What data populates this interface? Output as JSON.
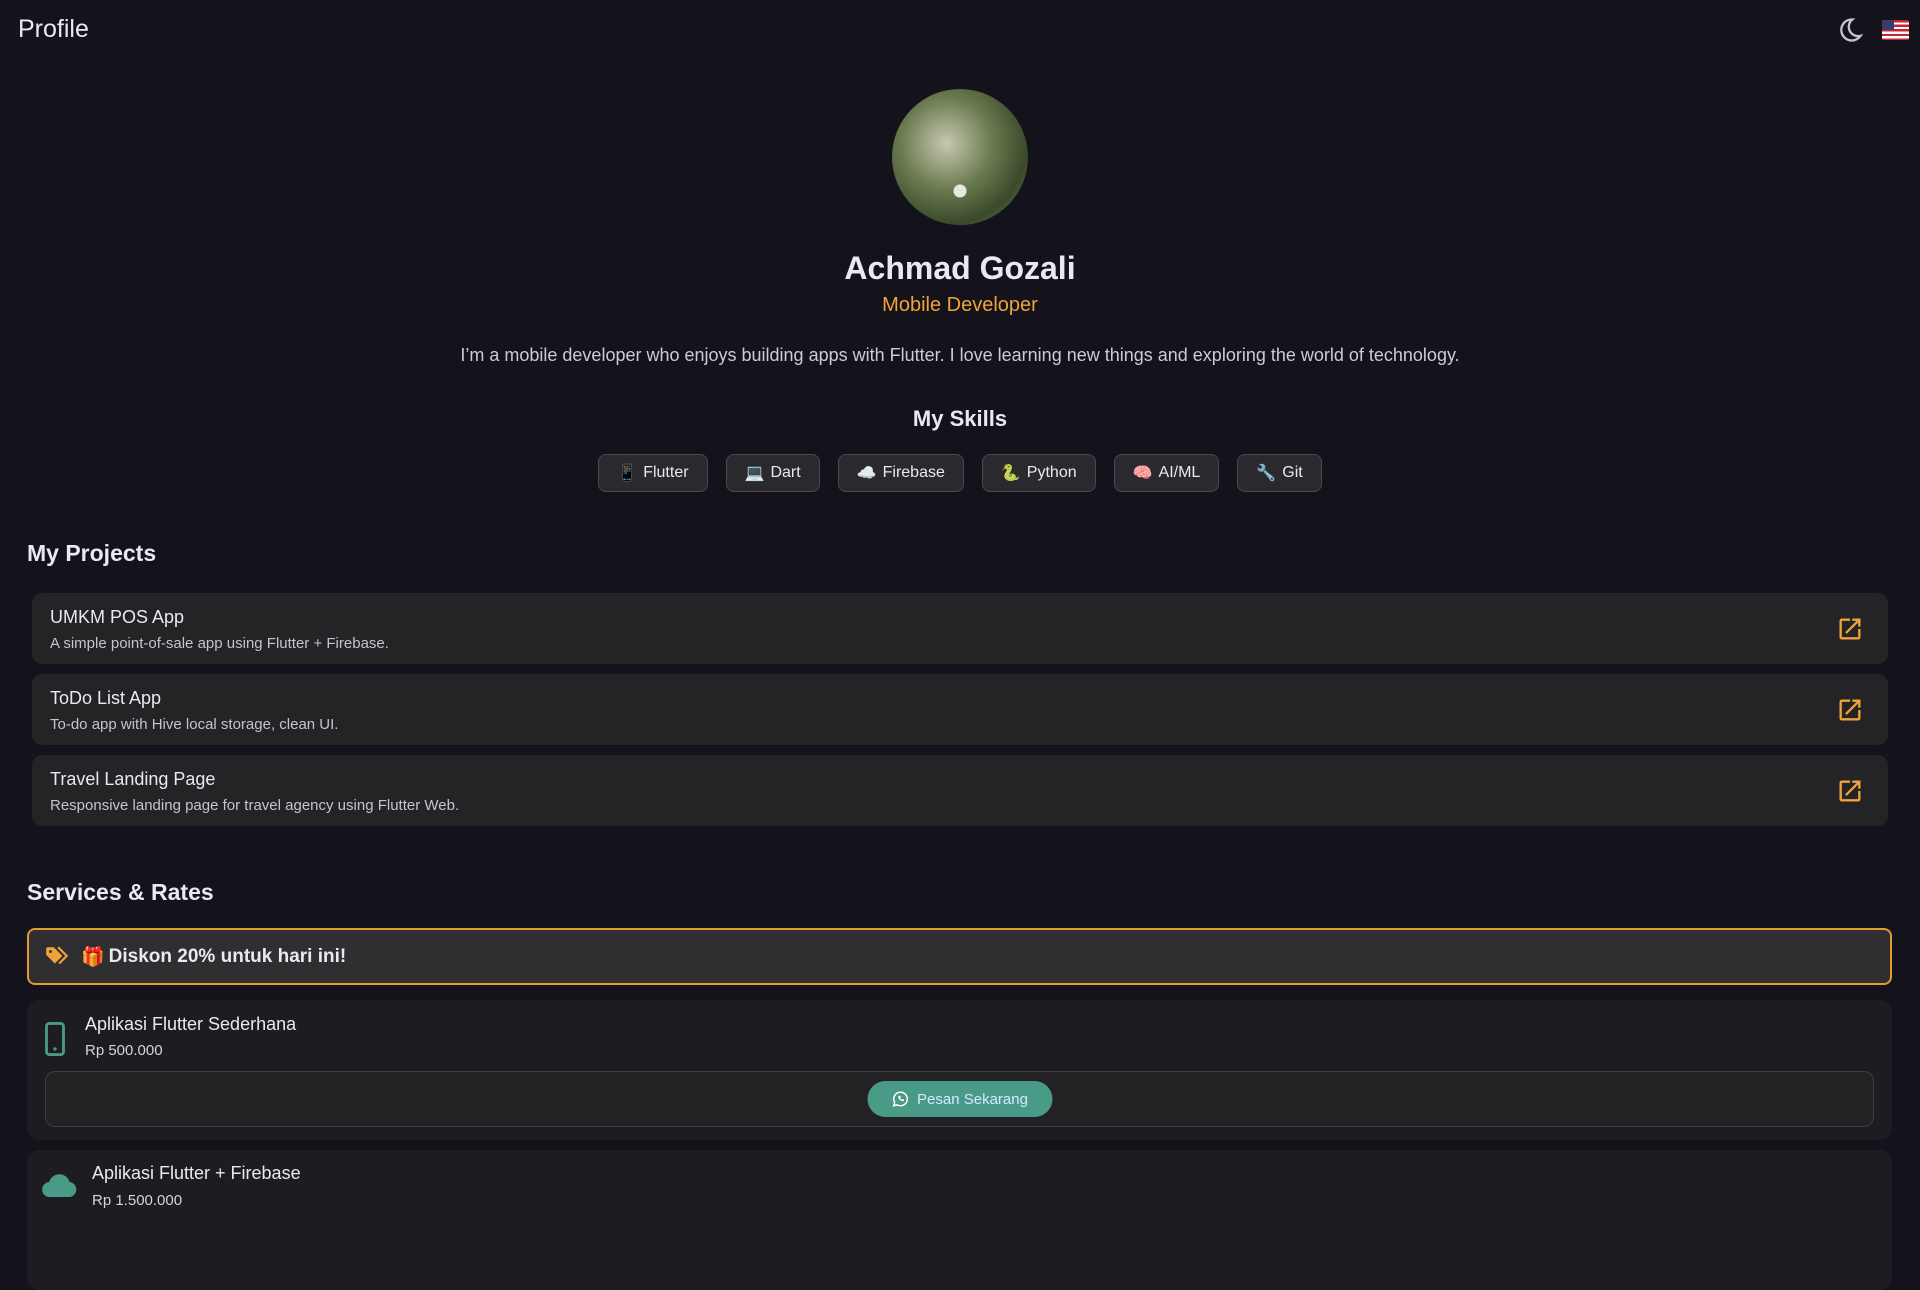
{
  "appbar": {
    "title": "Profile"
  },
  "profile": {
    "name": "Achmad Gozali",
    "role": "Mobile Developer",
    "bio": "I’m a mobile developer who enjoys building apps with Flutter. I love learning new things and exploring the world of technology."
  },
  "skills": {
    "heading": "My Skills",
    "items": [
      {
        "emoji": "📱",
        "label": "Flutter"
      },
      {
        "emoji": "💻",
        "label": "Dart"
      },
      {
        "emoji": "☁️",
        "label": "Firebase"
      },
      {
        "emoji": "🐍",
        "label": "Python"
      },
      {
        "emoji": "🧠",
        "label": "AI/ML"
      },
      {
        "emoji": "🔧",
        "label": "Git"
      }
    ]
  },
  "projects": {
    "heading": "My Projects",
    "items": [
      {
        "title": "UMKM POS App",
        "desc": "A simple point-of-sale app using Flutter + Firebase."
      },
      {
        "title": "ToDo List App",
        "desc": "To-do app with Hive local storage, clean UI."
      },
      {
        "title": "Travel Landing Page",
        "desc": "Responsive landing page for travel agency using Flutter Web."
      }
    ]
  },
  "services": {
    "heading": "Services & Rates",
    "promo": {
      "emoji": "🎁",
      "text": "Diskon 20% untuk hari ini!"
    },
    "items": [
      {
        "title": "Aplikasi Flutter Sederhana",
        "price": "Rp 500.000",
        "button": "Pesan Sekarang"
      },
      {
        "title": "Aplikasi Flutter + Firebase",
        "price": "Rp 1.500.000"
      }
    ]
  },
  "colors": {
    "accent": "#f0a33a",
    "teal": "#4a9a88",
    "bg": "#14121a"
  }
}
